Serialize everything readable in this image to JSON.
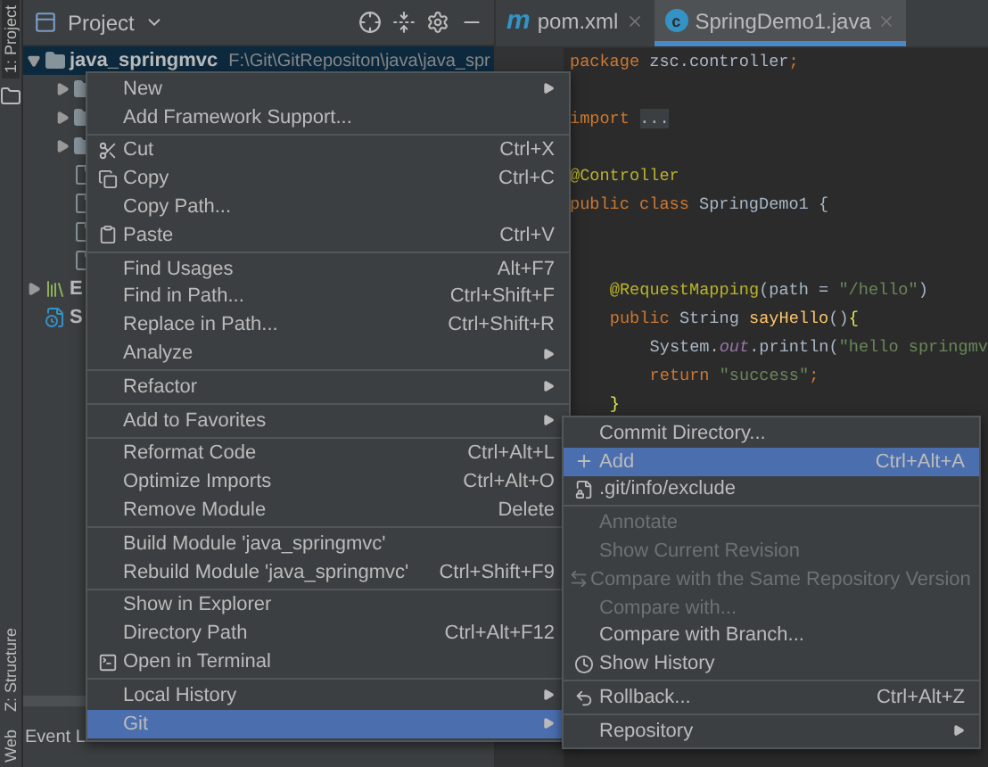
{
  "side_strip": {
    "tabs": [
      {
        "label": "1: Project",
        "selected": true
      },
      {
        "label": "Z: Structure",
        "selected": false
      },
      {
        "label": "Web",
        "selected": false
      }
    ]
  },
  "project": {
    "title": "Project",
    "tree": [
      {
        "name": "java_springmvc",
        "path": "F:\\Git\\GitRepositon\\java\\java_spr",
        "expanded": true,
        "selected": true,
        "children": [
          {
            "expanded": false,
            "selected": false
          },
          {
            "expanded": false,
            "selected": false
          },
          {
            "expanded": false,
            "selected": false
          },
          {
            "selected": false
          },
          {
            "selected": false
          },
          {
            "selected": false
          },
          {
            "selected": false
          }
        ]
      },
      {
        "name": "E",
        "expanded": false,
        "selected": false
      },
      {
        "name": "S",
        "selected": false
      }
    ],
    "bottom_tab": "Event L"
  },
  "editor": {
    "tabs": [
      {
        "icon_text": "m",
        "label": "pom.xml",
        "selected": false
      },
      {
        "icon_text": "c",
        "label": "SpringDemo1.java",
        "selected": true
      }
    ],
    "lines": [
      {
        "kind": "top",
        "tokens": [
          {
            "kind": "keyword",
            "text": "package"
          },
          {
            "kind": "plain",
            "text": " zsc.controller"
          },
          {
            "kind": "keyword",
            "text": ";"
          }
        ]
      },
      {
        "kind": "blank"
      },
      {
        "kind": "top",
        "tokens": [
          {
            "kind": "keyword",
            "text": "import"
          },
          {
            "kind": "fold",
            "text": "..."
          }
        ]
      },
      {
        "kind": "blank"
      },
      {
        "kind": "top",
        "tokens": [
          {
            "kind": "annotation",
            "text": "@Controller"
          }
        ]
      },
      {
        "kind": "top",
        "tokens": [
          {
            "kind": "keyword",
            "text": "public class"
          },
          {
            "kind": "plain",
            "text": " SpringDemo1 {"
          }
        ]
      },
      {
        "kind": "blank"
      },
      {
        "kind": "blank"
      },
      {
        "kind": "member",
        "tokens": [
          {
            "kind": "annotation",
            "text": "@RequestMapping"
          },
          {
            "kind": "plain",
            "text": "(path = "
          },
          {
            "kind": "string",
            "text": "\"/hello\""
          },
          {
            "kind": "plain",
            "text": ")"
          }
        ]
      },
      {
        "kind": "member",
        "tokens": [
          {
            "kind": "keyword",
            "text": "public"
          },
          {
            "kind": "plain",
            "text": " String "
          },
          {
            "kind": "method",
            "text": "sayHello"
          },
          {
            "kind": "plain",
            "text": "()"
          },
          {
            "kind": "brace",
            "text": "{"
          }
        ]
      },
      {
        "kind": "body",
        "tokens": [
          {
            "kind": "plain",
            "text": "System."
          },
          {
            "kind": "field",
            "text": "out"
          },
          {
            "kind": "plain",
            "text": ".println("
          },
          {
            "kind": "string",
            "text": "\"hello springmv"
          }
        ]
      },
      {
        "kind": "body",
        "tokens": [
          {
            "kind": "keyword",
            "text": "return"
          },
          {
            "kind": "string",
            "text": " \"success\""
          },
          {
            "kind": "keyword",
            "text": ";"
          }
        ]
      },
      {
        "kind": "member",
        "tokens": [
          {
            "kind": "brace",
            "text": "}"
          }
        ]
      }
    ]
  },
  "context_menu": {
    "items": [
      {
        "kind": "item",
        "label": "New",
        "submenu": true,
        "selected": false
      },
      {
        "kind": "item",
        "label": "Add Framework Support...",
        "selected": false
      },
      {
        "kind": "separator"
      },
      {
        "kind": "item",
        "label": "Cut",
        "shortcut": "Ctrl+X",
        "selected": false
      },
      {
        "kind": "item",
        "label": "Copy",
        "shortcut": "Ctrl+C",
        "selected": false
      },
      {
        "kind": "item",
        "label": "Copy Path...",
        "selected": false
      },
      {
        "kind": "item",
        "label": "Paste",
        "shortcut": "Ctrl+V",
        "selected": false
      },
      {
        "kind": "separator"
      },
      {
        "kind": "item",
        "label": "Find Usages",
        "shortcut": "Alt+F7",
        "selected": false
      },
      {
        "kind": "item",
        "label": "Find in Path...",
        "shortcut": "Ctrl+Shift+F",
        "selected": false
      },
      {
        "kind": "item",
        "label": "Replace in Path...",
        "shortcut": "Ctrl+Shift+R",
        "selected": false
      },
      {
        "kind": "item",
        "label": "Analyze",
        "submenu": true,
        "selected": false
      },
      {
        "kind": "separator"
      },
      {
        "kind": "item",
        "label": "Refactor",
        "submenu": true,
        "selected": false
      },
      {
        "kind": "separator"
      },
      {
        "kind": "item",
        "label": "Add to Favorites",
        "submenu": true,
        "selected": false
      },
      {
        "kind": "separator"
      },
      {
        "kind": "item",
        "label": "Reformat Code",
        "shortcut": "Ctrl+Alt+L",
        "selected": false
      },
      {
        "kind": "item",
        "label": "Optimize Imports",
        "shortcut": "Ctrl+Alt+O",
        "selected": false
      },
      {
        "kind": "item",
        "label": "Remove Module",
        "shortcut": "Delete",
        "selected": false
      },
      {
        "kind": "separator"
      },
      {
        "kind": "item",
        "label": "Build Module 'java_springmvc'",
        "selected": false
      },
      {
        "kind": "item",
        "label": "Rebuild Module 'java_springmvc'",
        "shortcut": "Ctrl+Shift+F9",
        "selected": false
      },
      {
        "kind": "separator"
      },
      {
        "kind": "item",
        "label": "Show in Explorer",
        "selected": false
      },
      {
        "kind": "item",
        "label": "Directory Path",
        "shortcut": "Ctrl+Alt+F12",
        "selected": false
      },
      {
        "kind": "item",
        "label": "Open in Terminal",
        "selected": false
      },
      {
        "kind": "separator"
      },
      {
        "kind": "item",
        "label": "Local History",
        "submenu": true,
        "selected": false
      },
      {
        "kind": "item",
        "label": "Git",
        "submenu": true,
        "selected": true
      }
    ]
  },
  "git_submenu": {
    "items": [
      {
        "kind": "item",
        "label": "Commit Directory...",
        "selected": false,
        "disabled": false
      },
      {
        "kind": "item",
        "label": "Add",
        "shortcut": "Ctrl+Alt+A",
        "selected": true,
        "disabled": false
      },
      {
        "kind": "item",
        "label": ".git/info/exclude",
        "selected": false,
        "disabled": false
      },
      {
        "kind": "separator"
      },
      {
        "kind": "item",
        "label": "Annotate",
        "selected": false,
        "disabled": true
      },
      {
        "kind": "item",
        "label": "Show Current Revision",
        "selected": false,
        "disabled": true
      },
      {
        "kind": "item",
        "label": "Compare with the Same Repository Version",
        "selected": false,
        "disabled": true
      },
      {
        "kind": "item",
        "label": "Compare with...",
        "selected": false,
        "disabled": true
      },
      {
        "kind": "item",
        "label": "Compare with Branch...",
        "selected": false,
        "disabled": false
      },
      {
        "kind": "item",
        "label": "Show History",
        "selected": false,
        "disabled": false
      },
      {
        "kind": "separator"
      },
      {
        "kind": "item",
        "label": "Rollback...",
        "shortcut": "Ctrl+Alt+Z",
        "selected": false,
        "disabled": false
      },
      {
        "kind": "separator"
      },
      {
        "kind": "item",
        "label": "Repository",
        "submenu": true,
        "selected": false,
        "disabled": false
      }
    ]
  }
}
